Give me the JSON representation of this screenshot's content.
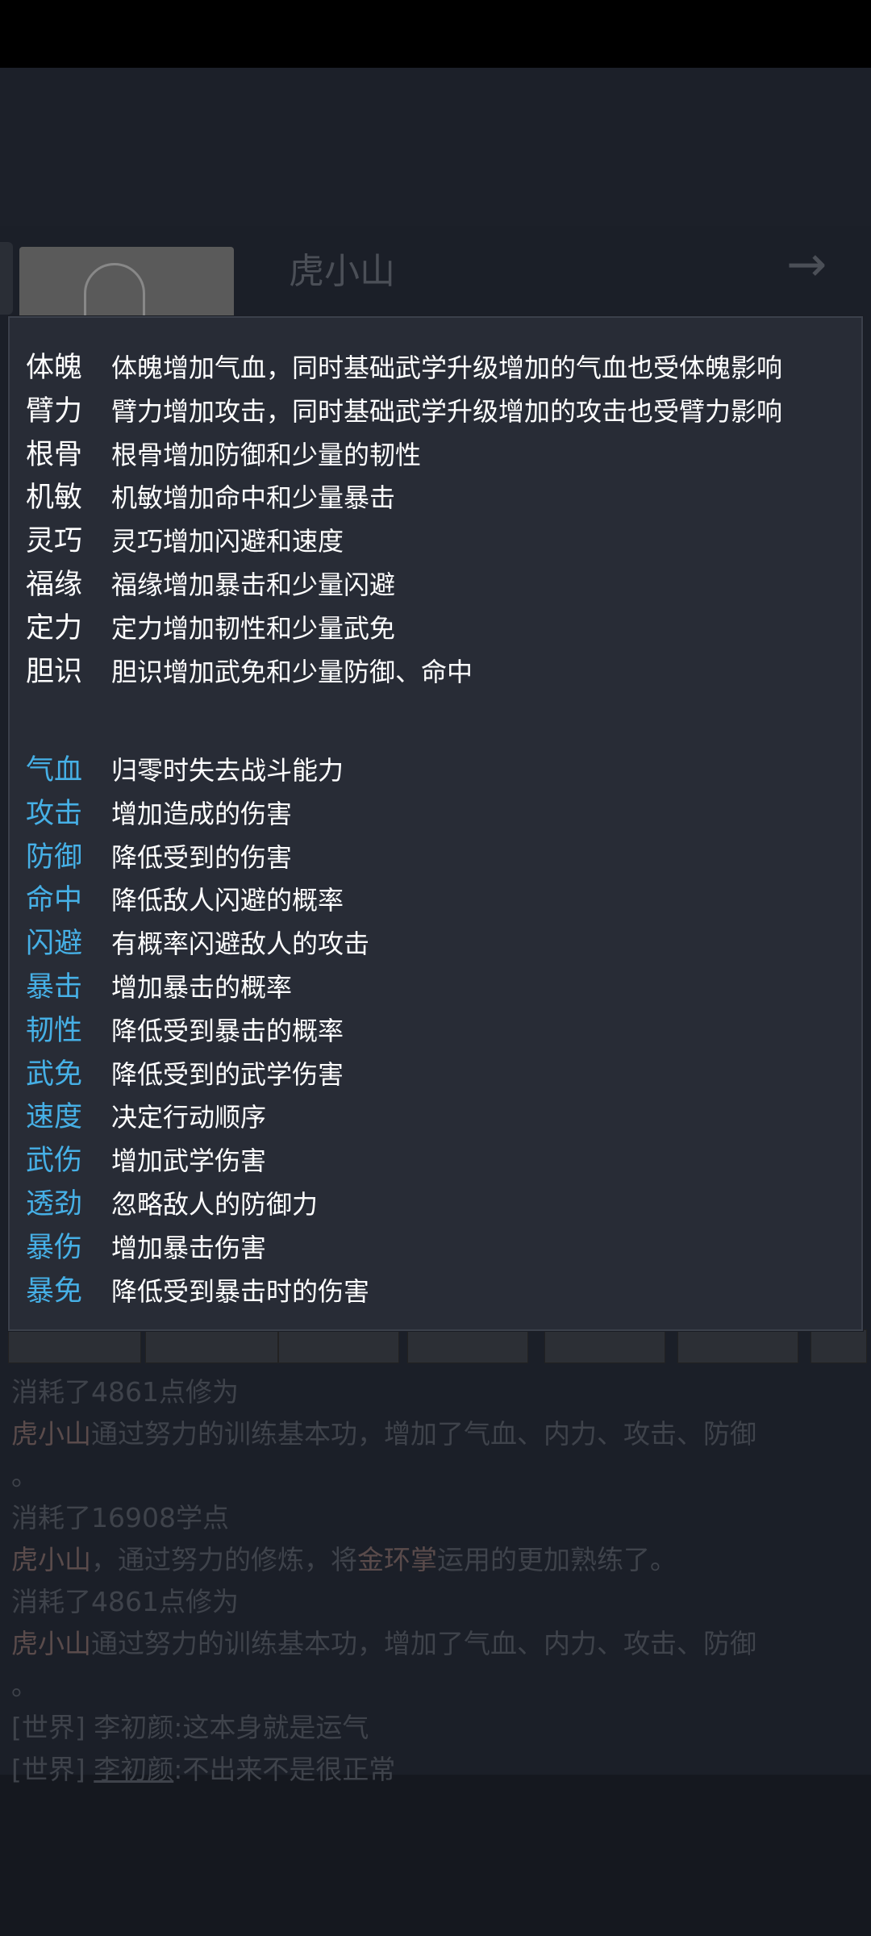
{
  "background": {
    "player_name": "虎小山",
    "next_arrow": "→",
    "log": [
      {
        "parts": [
          {
            "t": "消耗了4861点修为",
            "c": ""
          }
        ]
      },
      {
        "parts": [
          {
            "t": "虎小山",
            "c": "hl"
          },
          {
            "t": "通过努力的训练基本功，增加了气血、内力、攻击、防御",
            "c": ""
          }
        ]
      },
      {
        "parts": [
          {
            "t": "。",
            "c": ""
          }
        ]
      },
      {
        "parts": [
          {
            "t": "消耗了16908学点",
            "c": ""
          }
        ]
      },
      {
        "parts": [
          {
            "t": "虎小山",
            "c": "hl"
          },
          {
            "t": "，通过努力的修炼，将",
            "c": ""
          },
          {
            "t": "金环掌",
            "c": "hl"
          },
          {
            "t": "运用的更加熟练了。",
            "c": ""
          }
        ]
      },
      {
        "parts": [
          {
            "t": "消耗了4861点修为",
            "c": ""
          }
        ]
      },
      {
        "parts": [
          {
            "t": "虎小山",
            "c": "hl"
          },
          {
            "t": "通过努力的训练基本功，增加了气血、内力、攻击、防御",
            "c": ""
          }
        ]
      },
      {
        "parts": [
          {
            "t": "。",
            "c": ""
          }
        ]
      },
      {
        "parts": [
          {
            "t": "[世界] 李初颜:这本身就是运气",
            "c": ""
          }
        ]
      },
      {
        "parts": [
          {
            "t": "[世界] ",
            "c": ""
          },
          {
            "t": "李初颜",
            "c": "link"
          },
          {
            "t": ":不出来不是很正常",
            "c": ""
          }
        ]
      }
    ]
  },
  "tooltip": {
    "base_attributes": [
      {
        "term": "体魄",
        "desc": "体魄增加气血，同时基础武学升级增加的气血也受体魄影响"
      },
      {
        "term": "臂力",
        "desc": "臂力增加攻击，同时基础武学升级增加的攻击也受臂力影响"
      },
      {
        "term": "根骨",
        "desc": "根骨增加防御和少量的韧性"
      },
      {
        "term": "机敏",
        "desc": "机敏增加命中和少量暴击"
      },
      {
        "term": "灵巧",
        "desc": "灵巧增加闪避和速度"
      },
      {
        "term": "福缘",
        "desc": "福缘增加暴击和少量闪避"
      },
      {
        "term": "定力",
        "desc": "定力增加韧性和少量武免"
      },
      {
        "term": "胆识",
        "desc": "胆识增加武免和少量防御、命中"
      }
    ],
    "combat_stats": [
      {
        "term": "气血",
        "desc": "归零时失去战斗能力"
      },
      {
        "term": "攻击",
        "desc": "增加造成的伤害"
      },
      {
        "term": "防御",
        "desc": "降低受到的伤害"
      },
      {
        "term": "命中",
        "desc": "降低敌人闪避的概率"
      },
      {
        "term": "闪避",
        "desc": "有概率闪避敌人的攻击"
      },
      {
        "term": "暴击",
        "desc": "增加暴击的概率"
      },
      {
        "term": "韧性",
        "desc": "降低受到暴击的概率"
      },
      {
        "term": "武免",
        "desc": "降低受到的武学伤害"
      },
      {
        "term": "速度",
        "desc": "决定行动顺序"
      },
      {
        "term": "武伤",
        "desc": "增加武学伤害"
      },
      {
        "term": "透劲",
        "desc": "忽略敌人的防御力"
      },
      {
        "term": "暴伤",
        "desc": "增加暴击伤害"
      },
      {
        "term": "暴免",
        "desc": "降低受到暴击时的伤害"
      }
    ],
    "colors": {
      "base_term": "#ffffff",
      "combat_term": "#46b0e6",
      "background": "#282c36"
    }
  }
}
